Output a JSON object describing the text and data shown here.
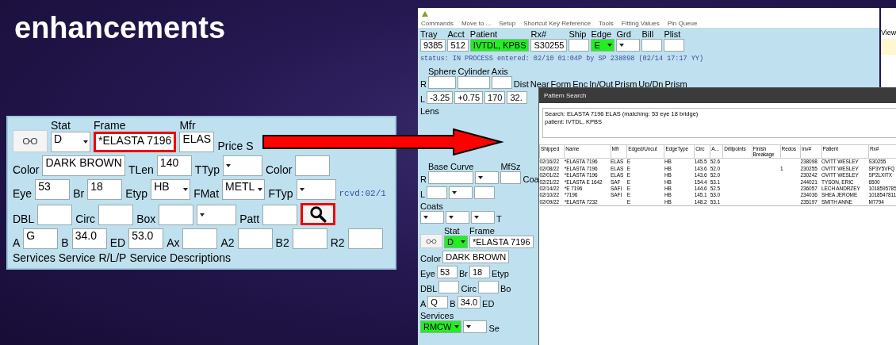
{
  "slide": {
    "title": "enhancements"
  },
  "left_form": {
    "rows": [
      {
        "items": [
          {
            "kind": "glasses-button"
          },
          {
            "kind": "dropdown",
            "label": "Stat",
            "value": "D",
            "highlighted": false
          },
          {
            "kind": "field",
            "label": "Frame",
            "value": "*ELASTA 7196",
            "highlighted": false,
            "callout": true
          },
          {
            "kind": "field",
            "label": "Mfr",
            "value": "ELAS",
            "highlighted": false
          },
          {
            "kind": "label",
            "text": "Price"
          },
          {
            "kind": "label",
            "text": "S"
          }
        ]
      },
      {
        "items": [
          {
            "kind": "label",
            "text": "Color"
          },
          {
            "kind": "field",
            "value": "DARK BROWN",
            "highlighted": false
          },
          {
            "kind": "label",
            "text": "TLen"
          },
          {
            "kind": "field",
            "value": "140",
            "highlighted": false
          },
          {
            "kind": "label",
            "text": "TTyp"
          },
          {
            "kind": "dropdown",
            "value": "",
            "highlighted": false
          },
          {
            "kind": "label",
            "text": "Color"
          },
          {
            "kind": "field",
            "value": "",
            "highlighted": false
          }
        ]
      },
      {
        "items": [
          {
            "kind": "label",
            "text": "Eye"
          },
          {
            "kind": "field",
            "value": "53",
            "highlighted": false
          },
          {
            "kind": "label",
            "text": "Br"
          },
          {
            "kind": "field",
            "value": "18",
            "highlighted": false
          },
          {
            "kind": "label",
            "text": "Etyp"
          },
          {
            "kind": "dropdown",
            "value": "HB",
            "highlighted": false
          },
          {
            "kind": "label",
            "text": "FMat"
          },
          {
            "kind": "dropdown",
            "value": "METL",
            "highlighted": false
          },
          {
            "kind": "label",
            "text": "FTyp"
          },
          {
            "kind": "dropdown",
            "value": "",
            "highlighted": false
          },
          {
            "kind": "note",
            "text": "rcvd:02/1"
          }
        ]
      },
      {
        "items": [
          {
            "kind": "label",
            "text": "DBL"
          },
          {
            "kind": "field",
            "value": "",
            "highlighted": false
          },
          {
            "kind": "label",
            "text": "Circ"
          },
          {
            "kind": "field",
            "value": "",
            "highlighted": false
          },
          {
            "kind": "label",
            "text": "Box"
          },
          {
            "kind": "field",
            "value": "",
            "highlighted": false
          },
          {
            "kind": "dropdown",
            "value": "",
            "highlighted": false
          },
          {
            "kind": "label",
            "text": "Patt"
          },
          {
            "kind": "field",
            "value": "",
            "highlighted": false
          },
          {
            "kind": "search-button",
            "callout": true
          }
        ]
      },
      {
        "items": [
          {
            "kind": "label",
            "text": "A"
          },
          {
            "kind": "field",
            "value": "G",
            "highlighted": false
          },
          {
            "kind": "label",
            "text": "B"
          },
          {
            "kind": "field",
            "value": "34.0",
            "highlighted": false
          },
          {
            "kind": "label",
            "text": "ED"
          },
          {
            "kind": "field",
            "value": "53.0",
            "highlighted": false
          },
          {
            "kind": "label",
            "text": "Ax"
          },
          {
            "kind": "field",
            "value": "",
            "highlighted": false
          },
          {
            "kind": "label",
            "text": "A2"
          },
          {
            "kind": "field",
            "value": "",
            "highlighted": false
          },
          {
            "kind": "label",
            "text": "B2"
          },
          {
            "kind": "field",
            "value": "",
            "highlighted": false
          },
          {
            "kind": "label",
            "text": "R2"
          },
          {
            "kind": "field",
            "value": "",
            "highlighted": false
          }
        ]
      },
      {
        "items": [
          {
            "kind": "label",
            "text": "Services"
          },
          {
            "kind": "label",
            "text": "Service"
          },
          {
            "kind": "label",
            "text": "R/L/P"
          },
          {
            "kind": "label",
            "text": "Service Descriptions"
          }
        ]
      }
    ]
  },
  "app_window": {
    "menu": [
      "Commands",
      "Move to ...",
      "Setup",
      "Shortcut Key Reference",
      "Tools",
      "Fitting Values",
      "Pin Queue"
    ],
    "rows": [
      {
        "items": [
          {
            "kind": "field",
            "label": "Tray",
            "value": "9385",
            "highlighted": false
          },
          {
            "kind": "field",
            "label": "Acct",
            "value": "512",
            "highlighted": false
          },
          {
            "kind": "field",
            "label": "Patient",
            "value": "IVTDL, KPBS",
            "highlighted": true
          },
          {
            "kind": "field",
            "label": "Rx#",
            "value": "S30255",
            "highlighted": false
          },
          {
            "kind": "field",
            "label": "Ship",
            "value": "",
            "highlighted": false
          },
          {
            "kind": "dropdown",
            "label": "Edge",
            "value": "E",
            "highlighted": true
          },
          {
            "kind": "dropdown",
            "label": "Grd",
            "value": "",
            "highlighted": false
          },
          {
            "kind": "field",
            "label": "Bill",
            "value": "",
            "highlighted": false
          },
          {
            "kind": "field",
            "label": "Plist",
            "value": "",
            "highlighted": false
          }
        ]
      },
      {
        "items": [
          {
            "kind": "note",
            "text": "status:  IN PROCESS entered: 02/10 01:04P by SP 238098 (02/14 17:17 YY)"
          }
        ]
      },
      {
        "items": [
          {
            "kind": "label",
            "text": "R"
          },
          {
            "kind": "field",
            "label": "Sphere",
            "value": "",
            "highlighted": false
          },
          {
            "kind": "field",
            "label": "Cylinder",
            "value": "",
            "highlighted": false
          },
          {
            "kind": "field",
            "label": "Axis",
            "value": "",
            "highlighted": false
          },
          {
            "kind": "label",
            "text": "Dist"
          },
          {
            "kind": "label",
            "text": "Near"
          },
          {
            "kind": "label",
            "text": "Form"
          },
          {
            "kind": "label",
            "text": "Enc"
          },
          {
            "kind": "label",
            "text": "In/Out"
          },
          {
            "kind": "label",
            "text": "Prism"
          },
          {
            "kind": "label",
            "text": "Up/Dn"
          },
          {
            "kind": "label",
            "text": "Prism"
          }
        ]
      },
      {
        "items": [
          {
            "kind": "label",
            "text": "L"
          },
          {
            "kind": "field",
            "value": "-3.25",
            "highlighted": false
          },
          {
            "kind": "field",
            "value": "+0.75",
            "highlighted": false
          },
          {
            "kind": "field",
            "value": "170",
            "highlighted": false
          },
          {
            "kind": "field",
            "value": "32.",
            "highlighted": false
          }
        ]
      },
      {
        "items": [
          {
            "kind": "label",
            "text": "Lens"
          }
        ]
      },
      {
        "items": [
          {
            "kind": "label",
            "text": "R"
          },
          {
            "kind": "field",
            "label": "Base Curve",
            "value": "",
            "highlighted": false
          },
          {
            "kind": "dropdown",
            "value": "",
            "highlighted": false
          },
          {
            "kind": "field",
            "label": "MfSz",
            "value": "",
            "highlighted": false
          },
          {
            "kind": "label",
            "text": "Coa"
          }
        ]
      },
      {
        "items": [
          {
            "kind": "label",
            "text": "L"
          },
          {
            "kind": "field",
            "value": "",
            "highlighted": false
          },
          {
            "kind": "dropdown",
            "value": "",
            "highlighted": false
          },
          {
            "kind": "field",
            "value": "",
            "highlighted": false
          }
        ]
      },
      {
        "items": [
          {
            "kind": "dropdown",
            "label": "Coats",
            "value": "",
            "highlighted": false
          },
          {
            "kind": "dropdown",
            "value": "",
            "highlighted": false
          },
          {
            "kind": "dropdown",
            "value": "",
            "highlighted": false
          },
          {
            "kind": "label",
            "text": "T"
          }
        ]
      },
      {
        "items": [
          {
            "kind": "glasses-button"
          },
          {
            "kind": "dropdown",
            "label": "Stat",
            "value": "D",
            "highlighted": true
          },
          {
            "kind": "field",
            "label": "Frame",
            "value": "*ELASTA 7196",
            "highlighted": false
          }
        ]
      },
      {
        "items": [
          {
            "kind": "label",
            "text": "Color"
          },
          {
            "kind": "field",
            "value": "DARK BROWN",
            "highlighted": false
          }
        ]
      },
      {
        "items": [
          {
            "kind": "label",
            "text": "Eye"
          },
          {
            "kind": "field",
            "value": "53",
            "highlighted": false
          },
          {
            "kind": "label",
            "text": "Br"
          },
          {
            "kind": "field",
            "value": "18",
            "highlighted": false
          },
          {
            "kind": "label",
            "text": "Etyp"
          }
        ]
      },
      {
        "items": [
          {
            "kind": "label",
            "text": "DBL"
          },
          {
            "kind": "field",
            "value": "",
            "highlighted": false
          },
          {
            "kind": "label",
            "text": "Circ"
          },
          {
            "kind": "field",
            "value": "",
            "highlighted": false
          },
          {
            "kind": "label",
            "text": "Bo"
          }
        ]
      },
      {
        "items": [
          {
            "kind": "label",
            "text": "A"
          },
          {
            "kind": "field",
            "value": "Q",
            "highlighted": false
          },
          {
            "kind": "label",
            "text": "B"
          },
          {
            "kind": "field",
            "value": "34.0",
            "highlighted": false
          },
          {
            "kind": "label",
            "text": "ED"
          }
        ]
      },
      {
        "items": [
          {
            "kind": "dropdown",
            "label": "Services",
            "value": "RMCW",
            "highlighted": true
          },
          {
            "kind": "dropdown",
            "value": "",
            "highlighted": false
          },
          {
            "kind": "label",
            "text": "Se"
          }
        ]
      }
    ]
  },
  "side_window": {
    "label": "View"
  },
  "pattern_search": {
    "title": "Pattern Search",
    "info": [
      "Search: ELASTA 7196 ELAS (matching: 53 eye 18 bridge)",
      "patient: IVTDL, KPBS"
    ],
    "columns": [
      "Shipped",
      "Name",
      "Mfr",
      "Edged/Uncut",
      "EdgeType",
      "Circ",
      "A...",
      "Drillpoints",
      "Finish Breakage",
      "Redos",
      "Inv#",
      "Patient",
      "Rx#"
    ],
    "rows": [
      [
        "02/16/22",
        "*ELASTA 7196",
        "ELAS",
        "E",
        "HB",
        "145.5",
        "52.6",
        "",
        "",
        "",
        "238098",
        "OVITT WESLEY",
        "S30255"
      ],
      [
        "02/08/22",
        "*ELASTA 7196",
        "ELAS",
        "E",
        "HB",
        "143.6",
        "52.0",
        "",
        "",
        "1",
        "230255",
        "OVITT WESLEY",
        "SP3Y5VFQ"
      ],
      [
        "02/01/22",
        "*ELASTA 7196",
        "ELAS",
        "E",
        "HB",
        "143.6",
        "52.0",
        "",
        "",
        "",
        "230242",
        "OVITT WESLEY",
        "SP2LXITX"
      ],
      [
        "02/21/22",
        "*ELASTA E 1642",
        "SAF",
        "E",
        "HB",
        "154.4",
        "53.1",
        "",
        "",
        "",
        "244021",
        "TYSON, ERIC",
        "6500"
      ],
      [
        "02/14/22",
        "*E 7196",
        "SAFI",
        "E",
        "HB",
        "144.6",
        "52.5",
        "",
        "",
        "",
        "236057",
        "LECH ANDRZEY",
        "1018595785"
      ],
      [
        "02/10/22",
        "*7196",
        "SAFI",
        "E",
        "HB",
        "145.1",
        "53.0",
        "",
        "",
        "",
        "234036",
        "SHEA JEROME",
        "1018547811"
      ],
      [
        "02/09/22",
        "*ELASTA 7232",
        "",
        "E",
        "HB",
        "148.2",
        "53.1",
        "",
        "",
        "",
        "235197",
        "SMITH ANNE",
        "M7794"
      ]
    ]
  }
}
